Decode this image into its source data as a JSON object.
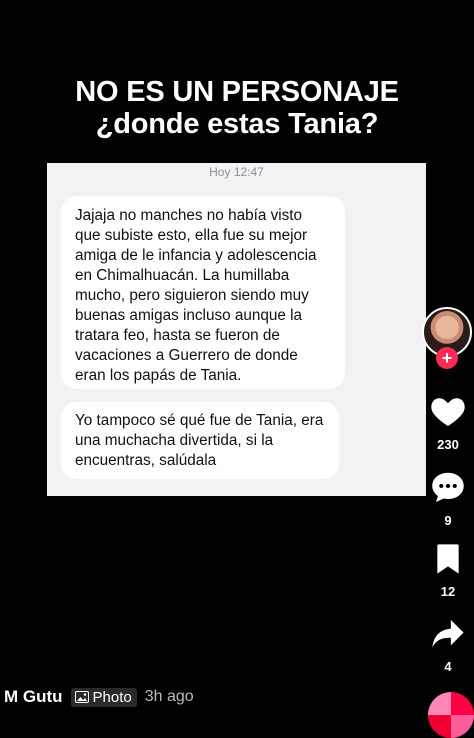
{
  "overlay": {
    "line1": "NO ES UN PERSONAJE",
    "line2": "¿donde estas Tania?"
  },
  "chat": {
    "timestamp": "Hoy 12:47",
    "messages": [
      {
        "lines": [
          "Jajaja no manches no había visto",
          "que subiste esto, ella fue su mejor",
          "amiga de le infancia y adolescencia",
          "en Chimalhuacán. La humillaba",
          "mucho, pero siguieron siendo muy",
          "buenas amigas incluso aunque la",
          "tratara feo, hasta se fueron de",
          "vacaciones a Guerrero de donde",
          "eran los papás de Tania."
        ]
      },
      {
        "lines": [
          "Yo tampoco sé qué fue de Tania, era",
          "una muchacha divertida, si la",
          "encuentras, salúdala"
        ]
      }
    ]
  },
  "rail": {
    "like_count": "230",
    "comment_count": "9",
    "save_count": "12",
    "share_count": "4",
    "follow_symbol": "+"
  },
  "footer": {
    "username": "M Gutu",
    "badge_label": "Photo",
    "time_ago": "3h ago"
  },
  "colors": {
    "background": "#000000",
    "accent": "#fe2c55",
    "bubble": "#ffffff",
    "chat_bg": "#f2f2f4"
  }
}
